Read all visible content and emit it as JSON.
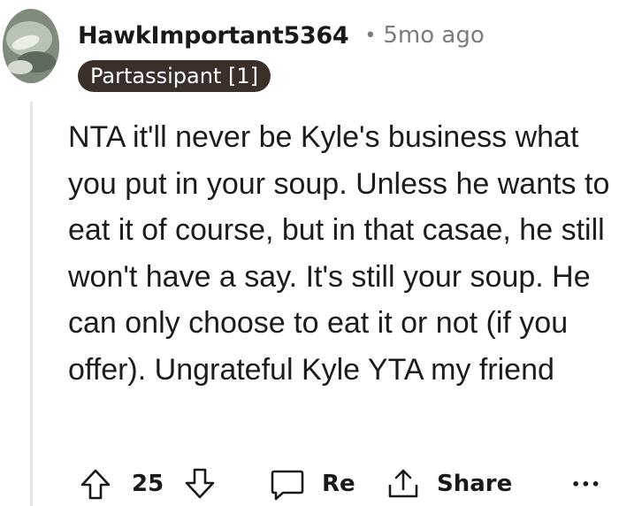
{
  "comment": {
    "username": "HawkImportant5364",
    "separator": "•",
    "timestamp": "5mo ago",
    "flair": "Partassipant [1]",
    "body": "NTA it'll never be Kyle's business what you put in your soup. Unless he wants to eat it of course, but in that casae, he still won't have a say. It's still your soup. He can only choose to eat it or not (if you offer). Ungrateful Kyle YTA my friend"
  },
  "actions": {
    "vote_count": "25",
    "reply_label": "Re",
    "share_label": "Share",
    "more_label": "•••"
  },
  "icons": {
    "upvote": "upvote-arrow-icon",
    "downvote": "downvote-arrow-icon",
    "reply": "speech-bubble-icon",
    "share": "share-icon",
    "more": "ellipsis-icon"
  },
  "colors": {
    "flair_background": "#3b2f2a",
    "meta_gray": "#7c7c7c",
    "thread_line": "#e3e6e8"
  }
}
